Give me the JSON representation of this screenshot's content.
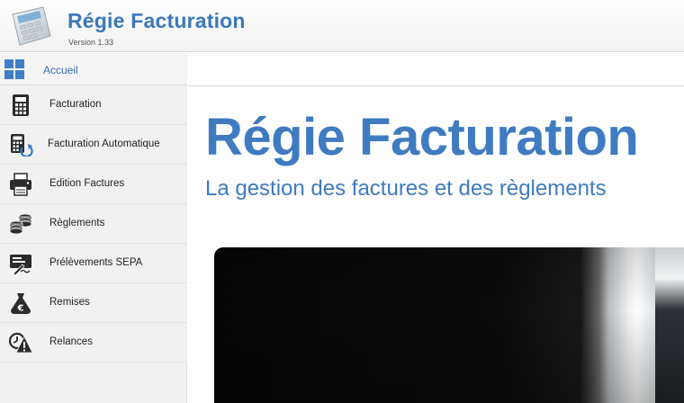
{
  "app": {
    "title": "Régie Facturation",
    "version": "Version 1.33",
    "logo_icon": "calculator-icon"
  },
  "sidebar": {
    "home": {
      "label": "Accueil",
      "icon": "grid-icon"
    },
    "items": [
      {
        "label": "Facturation",
        "icon": "calculator-icon"
      },
      {
        "label": "Facturation Automatique",
        "icon": "calculator-refresh-icon"
      },
      {
        "label": "Edition Factures",
        "icon": "printer-icon"
      },
      {
        "label": "Règlements",
        "icon": "coins-icon"
      },
      {
        "label": "Prélèvements SEPA",
        "icon": "signed-document-icon"
      },
      {
        "label": "Remises",
        "icon": "euro-bag-icon"
      },
      {
        "label": "Relances",
        "icon": "warning-clock-icon"
      }
    ]
  },
  "main": {
    "title": "Régie Facturation",
    "subtitle": "La gestion des factures et des règlements"
  },
  "colors": {
    "brand_blue": "#3e7bc1",
    "link_blue": "#3a6fb0",
    "sidebar_bg": "#f1f1f1",
    "icon_dark": "#2b2b2b"
  }
}
